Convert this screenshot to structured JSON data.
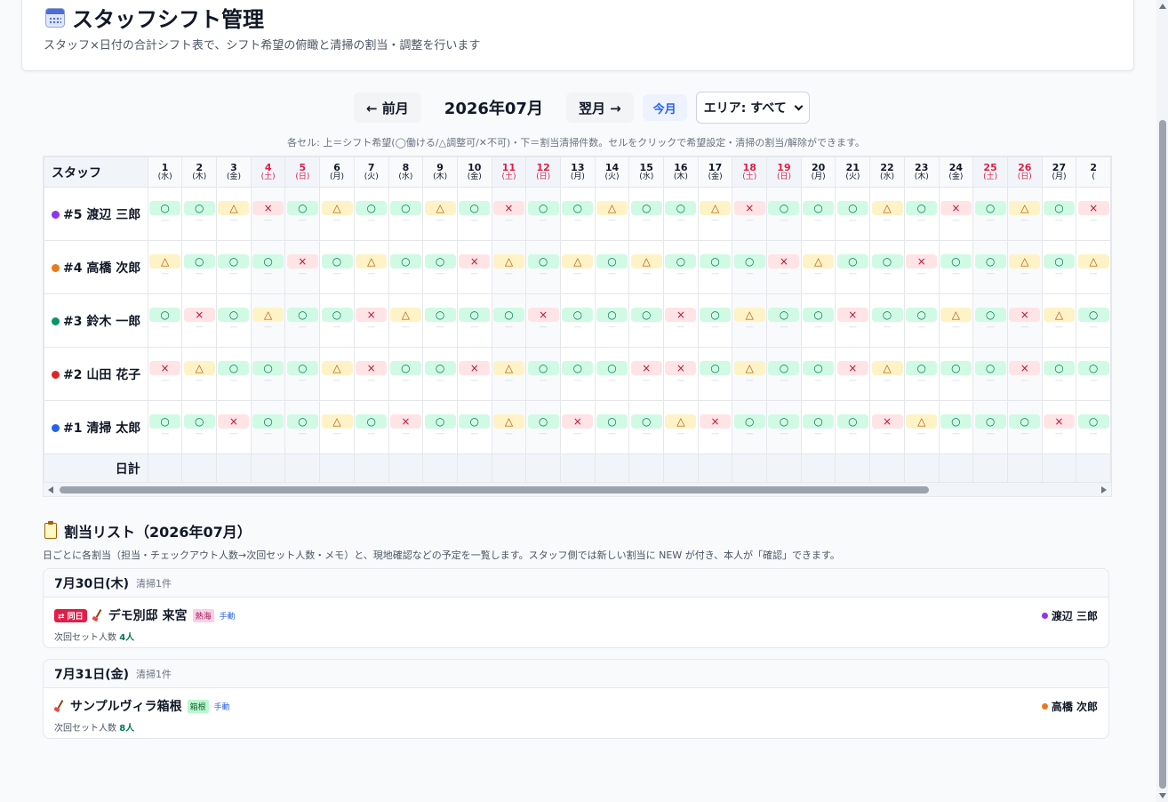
{
  "header": {
    "title": "スタッフシフト管理",
    "subtitle": "スタッフ×日付の合計シフト表で、シフト希望の俯瞰と清掃の割当・調整を行います"
  },
  "toolbar": {
    "prev_label": "← 前月",
    "month_label": "2026年07月",
    "next_label": "翌月 →",
    "today_label": "今月",
    "area_select_value": "エリア: すべて"
  },
  "legend_note": "各セル: 上＝シフト希望(◯働ける/△調整可/✕不可)・下＝割当清掃件数。セルをクリックで希望設定・清掃の割当/解除ができます。",
  "grid": {
    "staff_header": "スタッフ",
    "footer_label": "日計",
    "count_placeholder": "—",
    "days": [
      {
        "d": "1",
        "w": "(水)",
        "we": false
      },
      {
        "d": "2",
        "w": "(木)",
        "we": false
      },
      {
        "d": "3",
        "w": "(金)",
        "we": false
      },
      {
        "d": "4",
        "w": "(土)",
        "we": true
      },
      {
        "d": "5",
        "w": "(日)",
        "we": true
      },
      {
        "d": "6",
        "w": "(月)",
        "we": false
      },
      {
        "d": "7",
        "w": "(火)",
        "we": false
      },
      {
        "d": "8",
        "w": "(水)",
        "we": false
      },
      {
        "d": "9",
        "w": "(木)",
        "we": false
      },
      {
        "d": "10",
        "w": "(金)",
        "we": false
      },
      {
        "d": "11",
        "w": "(土)",
        "we": true
      },
      {
        "d": "12",
        "w": "(日)",
        "we": true
      },
      {
        "d": "13",
        "w": "(月)",
        "we": false
      },
      {
        "d": "14",
        "w": "(火)",
        "we": false
      },
      {
        "d": "15",
        "w": "(水)",
        "we": false
      },
      {
        "d": "16",
        "w": "(木)",
        "we": false
      },
      {
        "d": "17",
        "w": "(金)",
        "we": false
      },
      {
        "d": "18",
        "w": "(土)",
        "we": true
      },
      {
        "d": "19",
        "w": "(日)",
        "we": true
      },
      {
        "d": "20",
        "w": "(月)",
        "we": false
      },
      {
        "d": "21",
        "w": "(火)",
        "we": false
      },
      {
        "d": "22",
        "w": "(水)",
        "we": false
      },
      {
        "d": "23",
        "w": "(木)",
        "we": false
      },
      {
        "d": "24",
        "w": "(金)",
        "we": false
      },
      {
        "d": "25",
        "w": "(土)",
        "we": true
      },
      {
        "d": "26",
        "w": "(日)",
        "we": true
      },
      {
        "d": "27",
        "w": "(月)",
        "we": false
      },
      {
        "d": "2",
        "w": "(",
        "we": false
      }
    ],
    "staff": [
      {
        "name": "#5 渡辺 三郎",
        "color": "#9333ea",
        "marks": "o,o,t,x,o,t,o,o,t,o,x,o,o,t,o,o,t,x,o,o,o,t,o,x,o,t,o,x"
      },
      {
        "name": "#4 高橋 次郎",
        "color": "#ea7a1e",
        "marks": "t,o,o,o,x,o,t,o,o,x,t,o,t,o,t,o,o,o,x,t,o,o,x,o,o,t,o,t"
      },
      {
        "name": "#3 鈴木 一郎",
        "color": "#059669",
        "marks": "o,x,o,t,o,o,x,t,o,o,o,x,o,o,o,x,o,t,o,o,x,o,o,t,o,x,t,o"
      },
      {
        "name": "#2 山田 花子",
        "color": "#dc2626",
        "marks": "x,t,o,o,o,t,x,o,o,x,t,o,o,o,x,x,o,t,o,o,x,t,o,o,o,x,o,o"
      },
      {
        "name": "#1 清掃 太郎",
        "color": "#2563eb",
        "marks": "o,o,x,o,o,t,o,x,o,o,t,o,x,o,o,t,x,o,o,o,o,x,t,o,o,o,x,o"
      }
    ],
    "mark_symbols": {
      "o": "○",
      "t": "△",
      "x": "×"
    }
  },
  "assignments": {
    "title": "割当リスト（2026年07月）",
    "description": "日ごとに各割当（担当・チェックアウト人数→次回セット人数・メモ）と、現地確認などの予定を一覧します。スタッフ側では新しい割当に NEW が付き、本人が「確認」できます。",
    "days": [
      {
        "date": "7月30日(木)",
        "count": "清掃1件",
        "items": [
          {
            "badge": "⇄ 同日",
            "property": "デモ別邸 来宮",
            "area": "熱海",
            "area_style": "pink",
            "manual": "手動",
            "next_set_label": "次回セット人数",
            "next_set_value": "4人",
            "assignee": "渡辺 三郎",
            "assignee_color": "#9333ea"
          }
        ]
      },
      {
        "date": "7月31日(金)",
        "count": "清掃1件",
        "items": [
          {
            "badge": "",
            "property": "サンプルヴィラ箱根",
            "area": "箱根",
            "area_style": "green",
            "manual": "手動",
            "next_set_label": "次回セット人数",
            "next_set_value": "8人",
            "assignee": "高橋 次郎",
            "assignee_color": "#ea7a1e"
          }
        ]
      }
    ]
  }
}
